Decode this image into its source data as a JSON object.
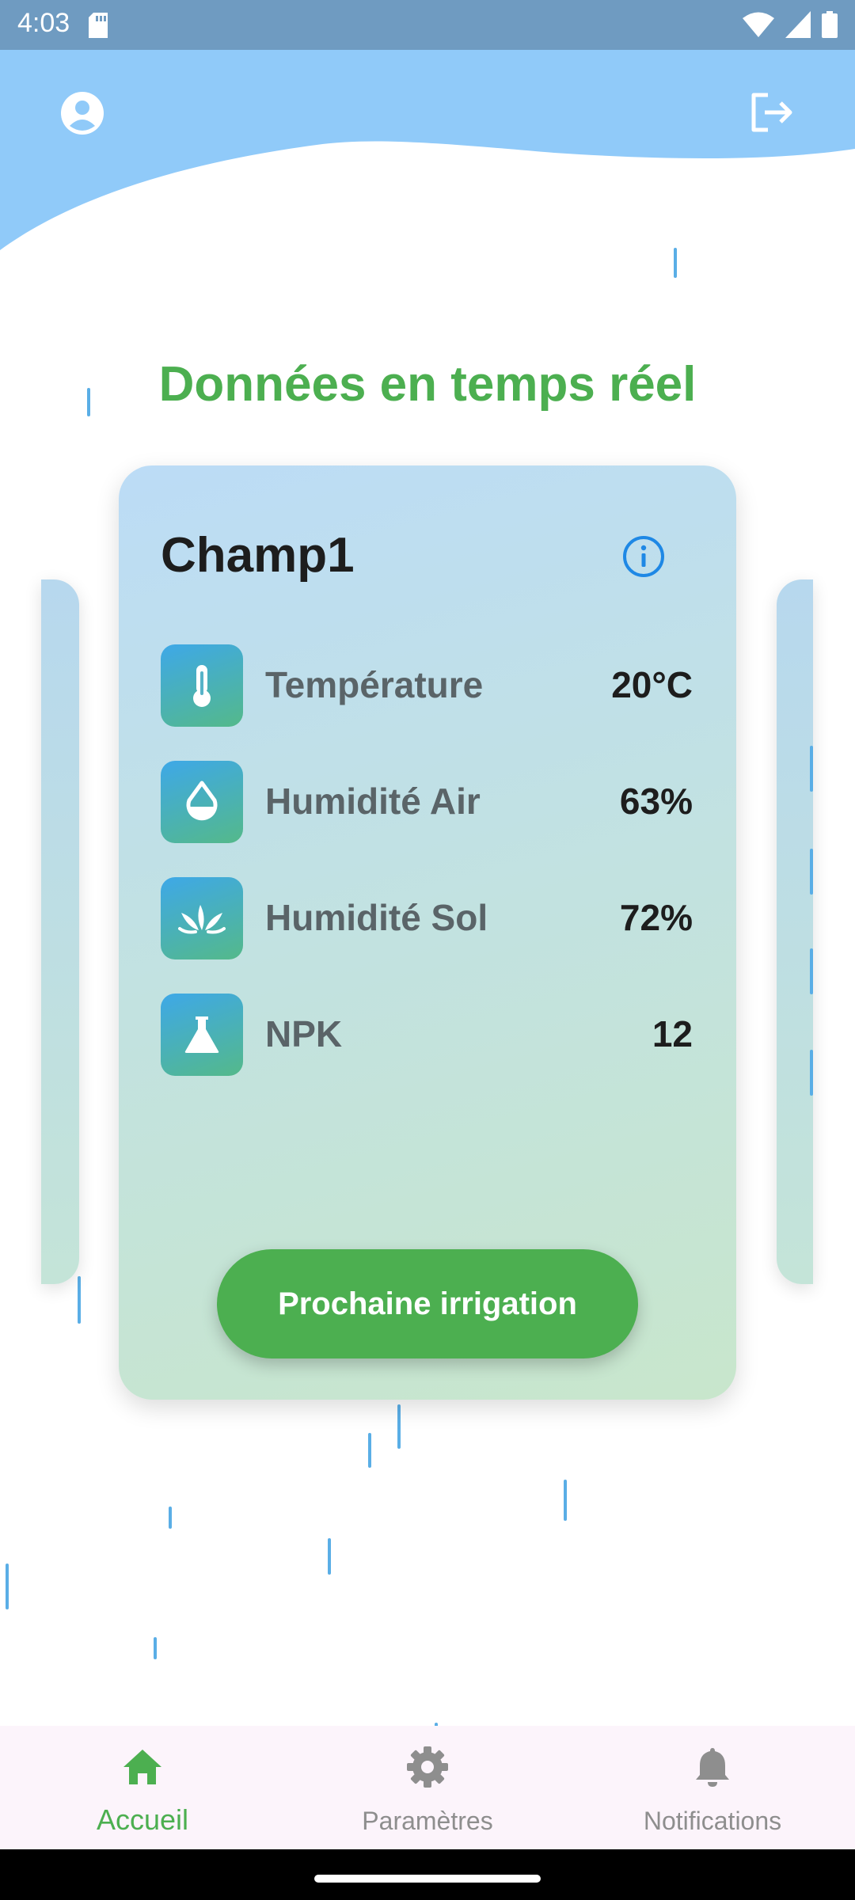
{
  "status_bar": {
    "time": "4:03"
  },
  "page": {
    "title": "Données en temps réel"
  },
  "card": {
    "title": "Champ1",
    "rows": [
      {
        "label": "Température",
        "value": "20°C",
        "icon": "thermometer-icon"
      },
      {
        "label": "Humidité Air",
        "value": "63%",
        "icon": "droplet-icon"
      },
      {
        "label": "Humidité Sol",
        "value": "72%",
        "icon": "plant-icon"
      },
      {
        "label": "NPK",
        "value": "12",
        "icon": "flask-icon"
      }
    ],
    "button_label": "Prochaine irrigation"
  },
  "bottom_nav": {
    "items": [
      {
        "label": "Accueil",
        "icon": "home-icon",
        "active": true
      },
      {
        "label": "Paramètres",
        "icon": "gear-icon",
        "active": false
      },
      {
        "label": "Notifications",
        "icon": "bell-icon",
        "active": false
      }
    ]
  },
  "colors": {
    "accent_green": "#4caf50",
    "header_blue": "#90caf9",
    "status_bar": "#6f9bc1",
    "rain_blue": "#5aaee6",
    "info_blue": "#1e88e5"
  }
}
